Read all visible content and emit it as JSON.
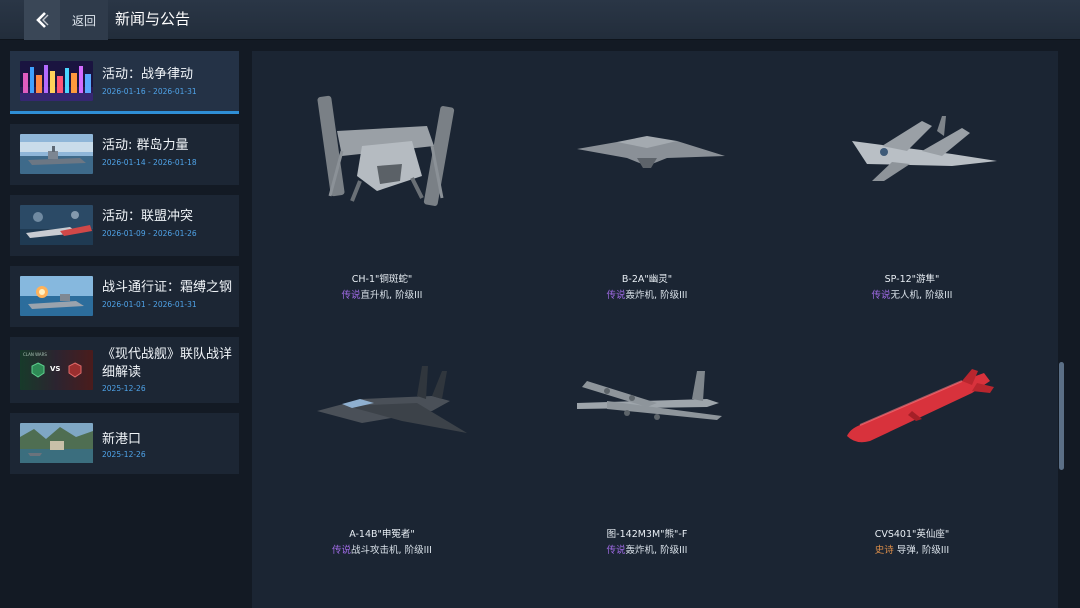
{
  "header": {
    "back_label": "返回",
    "title": "新闻与公告"
  },
  "sidebar": {
    "items": [
      {
        "title": "活动：战争律动",
        "date": "2026-01-16 - 2026-01-31",
        "active": true
      },
      {
        "title": "活动: 群岛力量",
        "date": "2026-01-14 - 2026-01-18",
        "active": false
      },
      {
        "title": "活动：联盟冲突",
        "date": "2026-01-09 - 2026-01-26",
        "active": false
      },
      {
        "title": "战斗通行证：霜缚之钢",
        "date": "2026-01-01 - 2026-01-31",
        "active": false
      },
      {
        "title": "《现代战舰》联队战详细解读",
        "date": "2025-12-26",
        "active": false,
        "thumb_text": "CLAN WARS",
        "vs": "VS"
      },
      {
        "title": "新港口",
        "date": "2025-12-26",
        "active": false
      }
    ]
  },
  "units": [
    {
      "name": "CH-1\"铜斑蛇\"",
      "rarity": "传说",
      "type": "直升机, 阶级III",
      "icon": "helicopter-icon"
    },
    {
      "name": "B-2A\"幽灵\"",
      "rarity": "传说",
      "type": "轰炸机, 阶级III",
      "icon": "stealth-bomber-icon"
    },
    {
      "name": "SP-12\"游隼\"",
      "rarity": "传说",
      "type": "无人机, 阶级III",
      "icon": "drone-icon"
    },
    {
      "name": "A-14B\"申冤者\"",
      "rarity": "传说",
      "type": "战斗攻击机, 阶级III",
      "icon": "attack-jet-icon"
    },
    {
      "name": "图-142M3M\"熊\"-F",
      "rarity": "传说",
      "type": "轰炸机, 阶级III",
      "icon": "turboprop-bomber-icon"
    },
    {
      "name": "CVS401\"英仙座\"",
      "rarity": "史诗",
      "type": " 导弹, 阶级III",
      "icon": "missile-icon"
    }
  ],
  "colors": {
    "accent": "#2f8fd6",
    "legendary": "#a06be6",
    "epic": "#e0904a",
    "date": "#4fa3e8"
  }
}
